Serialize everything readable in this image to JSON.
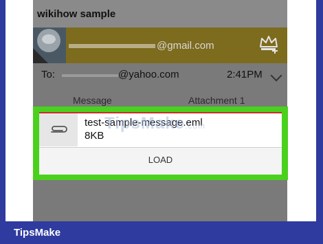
{
  "app": {
    "title": "wikihow sample"
  },
  "sender": {
    "email_suffix": "@gmail.com",
    "crown_icon": "crown-plus-icon"
  },
  "recipient": {
    "to_label": "To:",
    "email_suffix": "@yahoo.com",
    "time": "2:41PM"
  },
  "tabs": [
    {
      "label": "Message"
    },
    {
      "label": "Attachment 1"
    }
  ],
  "attachment": {
    "filename": "test-sample-message.eml",
    "size": "8KB",
    "load_label": "LOAD",
    "icon": "paperclip-icon"
  },
  "watermark": {
    "text": "TipsMake",
    "suffix": ".com"
  },
  "footer": {
    "brand": "TipsMake"
  },
  "colors": {
    "highlight": "#49d11d",
    "footer": "#2f3b9e",
    "sender_bar": "#7d6b1e"
  }
}
